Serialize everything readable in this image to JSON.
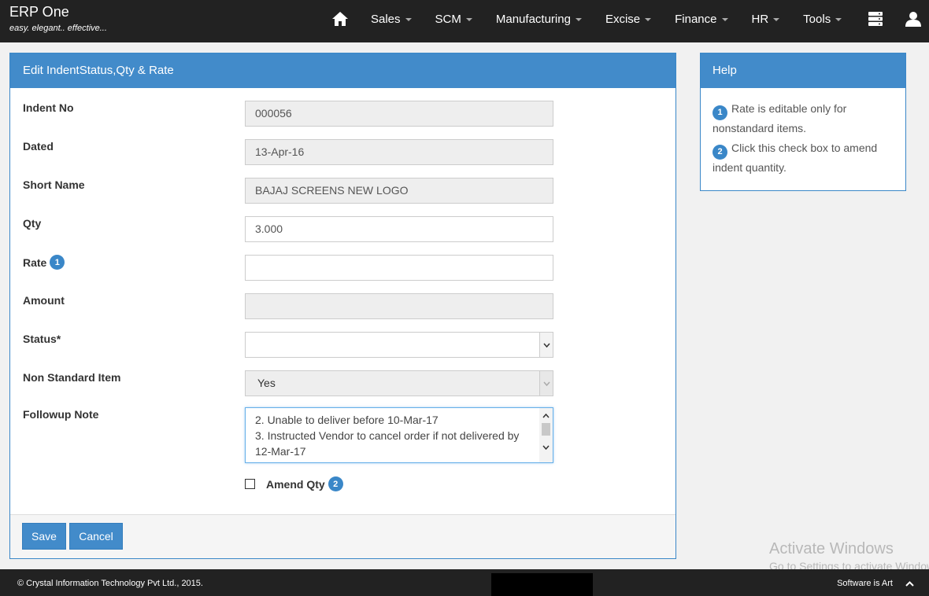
{
  "brand": {
    "title": "ERP One",
    "tagline": "easy. elegant.. effective..."
  },
  "nav": {
    "items": [
      {
        "label": "Sales"
      },
      {
        "label": "SCM"
      },
      {
        "label": "Manufacturing"
      },
      {
        "label": "Excise"
      },
      {
        "label": "Finance"
      },
      {
        "label": "HR"
      },
      {
        "label": "Tools"
      }
    ],
    "icons": [
      "home-icon",
      "database-icon",
      "user-icon"
    ]
  },
  "form": {
    "heading": "Edit IndentStatus,Qty & Rate",
    "indent_no": {
      "label": "Indent No",
      "value": "000056"
    },
    "dated": {
      "label": "Dated",
      "value": "13-Apr-16"
    },
    "short_name": {
      "label": "Short Name",
      "value": "BAJAJ SCREENS NEW LOGO"
    },
    "qty": {
      "label": "Qty",
      "value": "3.000"
    },
    "rate": {
      "label": "Rate",
      "badge": "1",
      "value": ""
    },
    "amount": {
      "label": "Amount",
      "value": ""
    },
    "status": {
      "label": "Status*",
      "value": ""
    },
    "non_standard": {
      "label": "Non Standard Item",
      "value": "Yes"
    },
    "followup": {
      "label": "Followup Note",
      "lines": [
        "2. Unable to deliver before 10-Mar-17",
        "3. Instructed Vendor to cancel order if not delivered by",
        "12-Mar-17"
      ]
    },
    "amend_qty": {
      "label": "Amend Qty",
      "badge": "2",
      "checked": false
    },
    "save_label": "Save",
    "cancel_label": "Cancel"
  },
  "help": {
    "heading": "Help",
    "items": [
      {
        "badge": "1",
        "text": "Rate is editable only for nonstandard items."
      },
      {
        "badge": "2",
        "text": "Click this check box to amend indent quantity."
      }
    ]
  },
  "watermark": {
    "title": "Activate Windows",
    "subtitle": "Go to Settings to activate Windows."
  },
  "footer": {
    "copyright": "© Crystal Information Technology Pvt Ltd., 2015.",
    "right_text": "Software is Art"
  },
  "colors": {
    "primary": "#428bca",
    "topbar": "#222222",
    "readonly_bg": "#eeeeee"
  }
}
